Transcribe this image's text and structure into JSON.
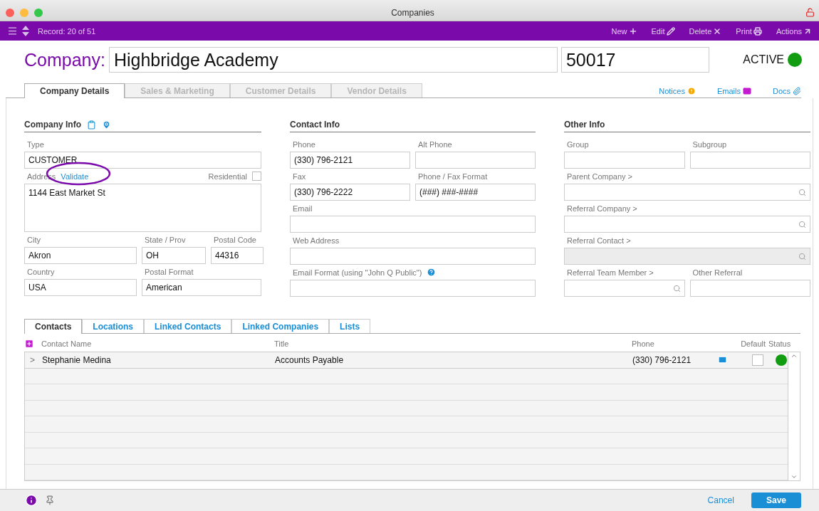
{
  "window": {
    "title": "Companies"
  },
  "toolbar": {
    "record": "Record: 20 of 51",
    "actions": [
      {
        "label": "New",
        "kind": "new"
      },
      {
        "label": "Edit",
        "kind": "edit"
      },
      {
        "label": "Delete",
        "kind": "delete"
      },
      {
        "label": "Print",
        "kind": "print"
      },
      {
        "label": "Actions",
        "kind": "actions"
      }
    ]
  },
  "header": {
    "label": "Company:",
    "name": "Highbridge Academy",
    "number": "50017",
    "status": {
      "label": "ACTIVE",
      "color": "#129c12"
    }
  },
  "tabs": [
    {
      "label": "Company Details",
      "selected": true
    },
    {
      "label": "Sales & Marketing",
      "selected": false
    },
    {
      "label": "Customer Details",
      "selected": false
    },
    {
      "label": "Vendor Details",
      "selected": false
    }
  ],
  "tab_links": [
    {
      "label": "Notices",
      "kind": "notices"
    },
    {
      "label": "Emails",
      "kind": "emails"
    },
    {
      "label": "Docs",
      "kind": "docs"
    }
  ],
  "sections": [
    {
      "title": "Company Info",
      "icons": true,
      "rows": [
        [
          {
            "label": "Type",
            "value": "CUSTOMER",
            "kind": "text"
          }
        ],
        [
          {
            "label": "Address",
            "link": "Validate",
            "checkbox": {
              "label": "Residential",
              "checked": false
            },
            "value": "1144 East Market St",
            "kind": "textarea"
          }
        ],
        [
          {
            "label": "City",
            "value": "Akron",
            "kind": "text"
          },
          {
            "label": "State / Prov",
            "value": "OH",
            "kind": "text"
          },
          {
            "label": "Postal Code",
            "value": "44316",
            "kind": "text"
          }
        ],
        [
          {
            "label": "Country",
            "value": "USA",
            "kind": "text"
          },
          {
            "label": "Postal Format",
            "value": "American",
            "kind": "text"
          }
        ]
      ]
    },
    {
      "title": "Contact Info",
      "icons": false,
      "rows": [
        [
          {
            "label": "Phone",
            "value": "(330) 796-2121",
            "kind": "text"
          },
          {
            "label": "Alt Phone",
            "kind": "text"
          }
        ],
        [
          {
            "label": "Fax",
            "value": "(330) 796-2222",
            "kind": "text"
          },
          {
            "label": "Phone / Fax Format",
            "value": "(###) ###-####",
            "kind": "text"
          }
        ],
        [
          {
            "label": "Email",
            "kind": "text"
          }
        ],
        [
          {
            "label": "Web Address",
            "kind": "text"
          }
        ],
        [
          {
            "label": "Email Format (using \"John Q Public\")",
            "help": true,
            "kind": "text"
          }
        ]
      ]
    },
    {
      "title": "Other Info",
      "icons": false,
      "rows": [
        [
          {
            "label": "Group",
            "kind": "text"
          },
          {
            "label": "Subgroup",
            "kind": "text"
          }
        ],
        [
          {
            "label": "Parent Company >",
            "kind": "lookup",
            "disabled": false
          }
        ],
        [
          {
            "label": "Referral Company >",
            "kind": "lookup",
            "disabled": false
          }
        ],
        [
          {
            "label": "Referral Contact >",
            "kind": "lookup",
            "disabled": true
          }
        ],
        [
          {
            "label": "Referral Team Member >",
            "kind": "lookup",
            "disabled": false
          },
          {
            "label": "Other Referral",
            "kind": "text"
          }
        ]
      ]
    }
  ],
  "contact_tabs": [
    {
      "label": "Contacts",
      "selected": true
    },
    {
      "label": "Locations",
      "selected": false
    },
    {
      "label": "Linked Contacts",
      "selected": false
    },
    {
      "label": "Linked Companies",
      "selected": false
    },
    {
      "label": "Lists",
      "selected": false
    }
  ],
  "contacts": {
    "columns": [
      "Contact Name",
      "Title",
      "Phone",
      "Default",
      "Status"
    ],
    "rows": [
      {
        "expander": ">",
        "name": "Stephanie Medina",
        "title": "Accounts Payable",
        "phone": "(330) 796-2121",
        "default": false,
        "color": "#129c12"
      }
    ]
  },
  "footer": {
    "cancel": "Cancel",
    "save": "Save"
  }
}
